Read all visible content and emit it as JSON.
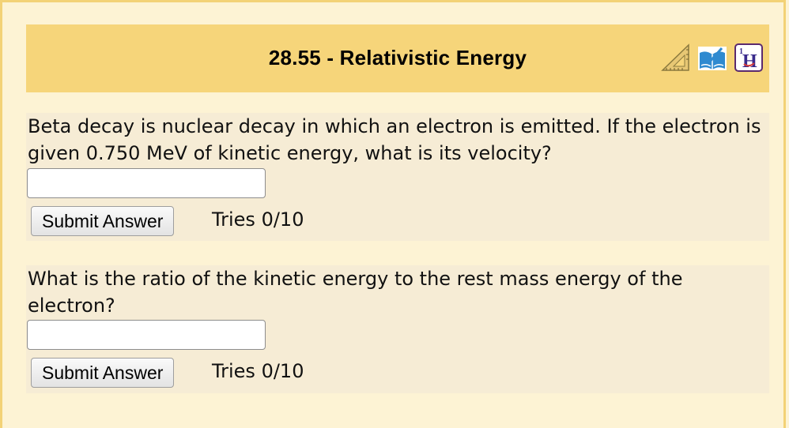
{
  "header": {
    "title": "28.55 - Relativistic Energy",
    "icons": [
      {
        "name": "ruler-triangle-icon"
      },
      {
        "name": "book-icon"
      },
      {
        "name": "hint-icon",
        "label": "H"
      }
    ]
  },
  "parts": [
    {
      "question": "Beta decay is nuclear decay in which an electron is emitted. If the electron is given 0.750 MeV of kinetic energy, what is its velocity?",
      "answer_value": "",
      "answer_placeholder": "",
      "submit_label": "Submit Answer",
      "tries": "Tries 0/10"
    },
    {
      "question": "What is the ratio of the kinetic energy to the rest mass energy of the electron?",
      "answer_value": "",
      "answer_placeholder": "",
      "submit_label": "Submit Answer",
      "tries": "Tries 0/10"
    }
  ],
  "colors": {
    "page_background": "#fdf3d4",
    "header_background": "#f6d57a",
    "part_background": "#f6ecd5",
    "frame_border": "#f3d276"
  }
}
